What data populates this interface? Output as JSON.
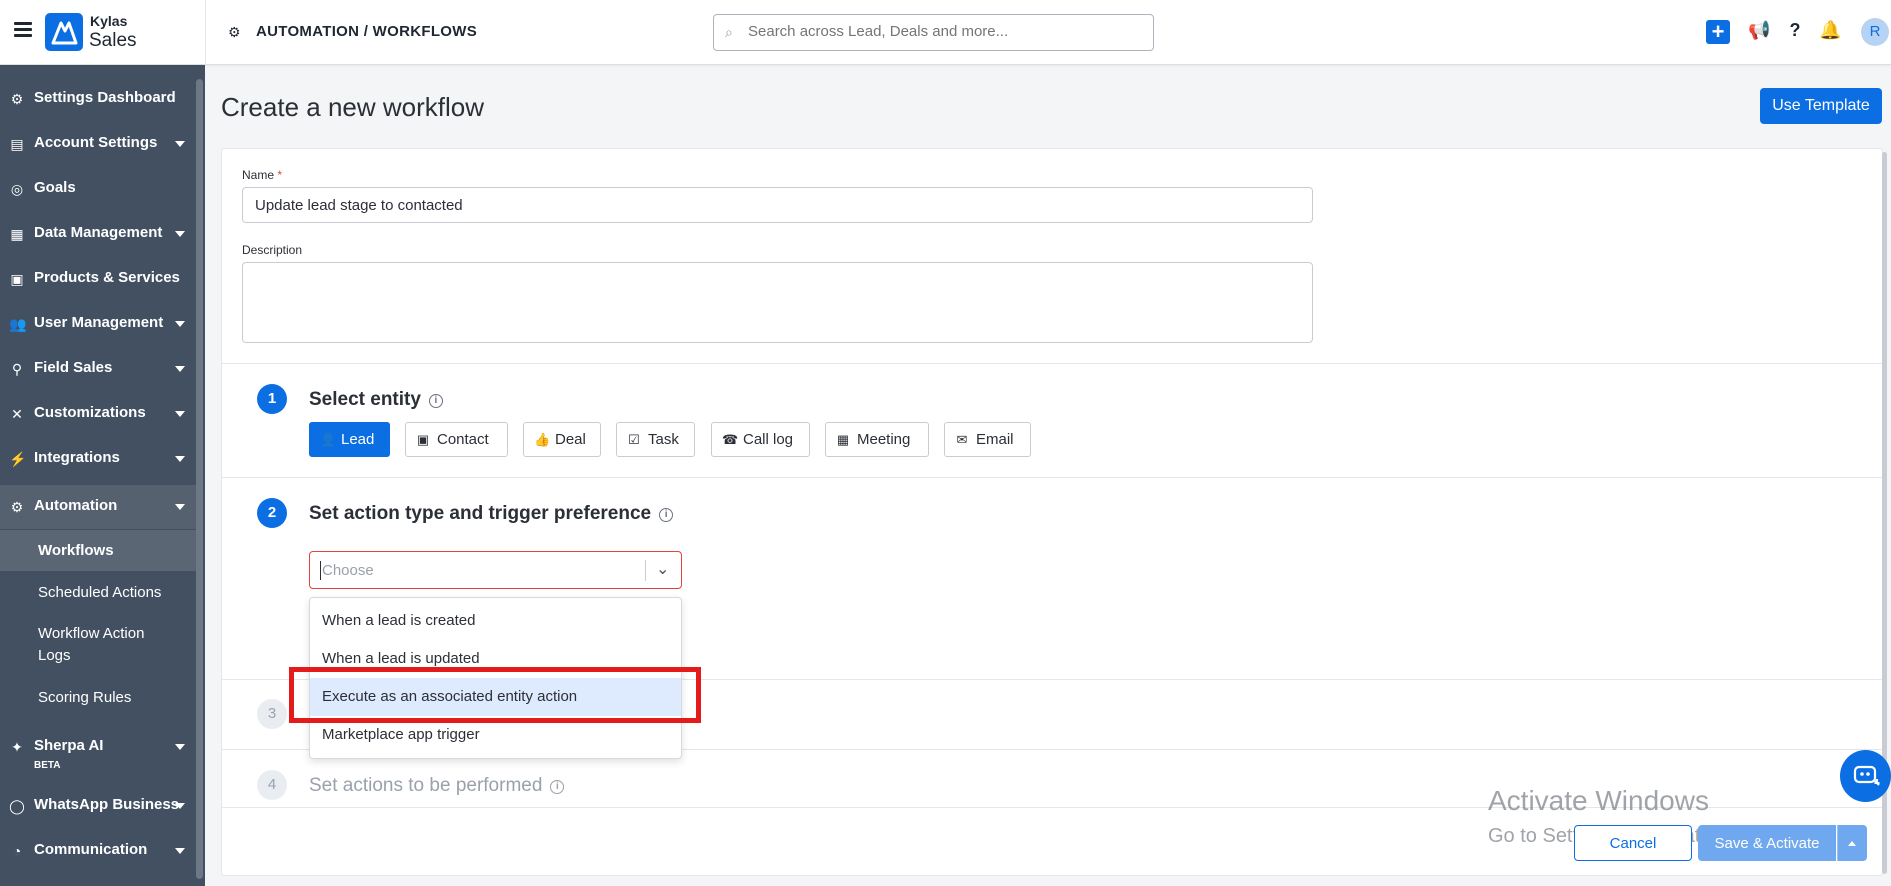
{
  "app": {
    "brand_top": "Kylas",
    "brand_bottom": "Sales"
  },
  "header": {
    "breadcrumb": "AUTOMATION / WORKFLOWS",
    "search_placeholder": "Search across Lead, Deals and more...",
    "avatar_initial": "R"
  },
  "sidebar": {
    "items": [
      {
        "label": "Settings Dashboard",
        "icon": "gear-icon"
      },
      {
        "label": "Account Settings",
        "icon": "account-icon"
      },
      {
        "label": "Goals",
        "icon": "target-icon"
      },
      {
        "label": "Data Management",
        "icon": "table-icon"
      },
      {
        "label": "Products & Services",
        "icon": "box-icon"
      },
      {
        "label": "User Management",
        "icon": "users-icon"
      },
      {
        "label": "Field Sales",
        "icon": "location-icon"
      },
      {
        "label": "Customizations",
        "icon": "tools-icon"
      },
      {
        "label": "Integrations",
        "icon": "plug-icon"
      },
      {
        "label": "Automation",
        "icon": "gears-icon"
      },
      {
        "label": "Sherpa AI",
        "icon": "sparkle-icon",
        "badge": "BETA"
      },
      {
        "label": "WhatsApp Business",
        "icon": "whatsapp-icon"
      },
      {
        "label": "Communication",
        "icon": "signal-icon"
      }
    ],
    "automation_sub": [
      "Workflows",
      "Scheduled Actions",
      "Workflow Action Logs",
      "Scoring Rules"
    ]
  },
  "main": {
    "title": "Create a new workflow",
    "use_template": "Use Template",
    "name_label": "Name",
    "name_required": "*",
    "name_value": "Update lead stage to contacted",
    "description_label": "Description",
    "description_value": "",
    "steps": [
      {
        "num": "1",
        "title": "Select entity"
      },
      {
        "num": "2",
        "title": "Set action type and trigger preference"
      },
      {
        "num": "3",
        "title": ""
      },
      {
        "num": "4",
        "title": "Set actions to be performed"
      }
    ],
    "entities": [
      {
        "label": "Lead",
        "icon": "user-icon",
        "selected": true
      },
      {
        "label": "Contact",
        "icon": "contact-card-icon"
      },
      {
        "label": "Deal",
        "icon": "thumbs-up-icon"
      },
      {
        "label": "Task",
        "icon": "checkbox-icon"
      },
      {
        "label": "Call log",
        "icon": "phone-icon"
      },
      {
        "label": "Meeting",
        "icon": "calendar-icon"
      },
      {
        "label": "Email",
        "icon": "envelope-icon"
      }
    ],
    "trigger_placeholder": "Choose",
    "trigger_options": [
      "When a lead is created",
      "When a lead is updated",
      "Execute as an associated entity action",
      "Marketplace app trigger"
    ],
    "highlighted_option": "Execute as an associated entity action",
    "cancel": "Cancel",
    "save": "Save & Activate"
  },
  "overlay": {
    "watermark_title": "Activate Windows",
    "watermark_sub": "Go to Settings to activate Windows."
  },
  "colors": {
    "primary": "#0b6fe3",
    "sidebar": "#425062",
    "highlight_box": "#e31b1b"
  }
}
